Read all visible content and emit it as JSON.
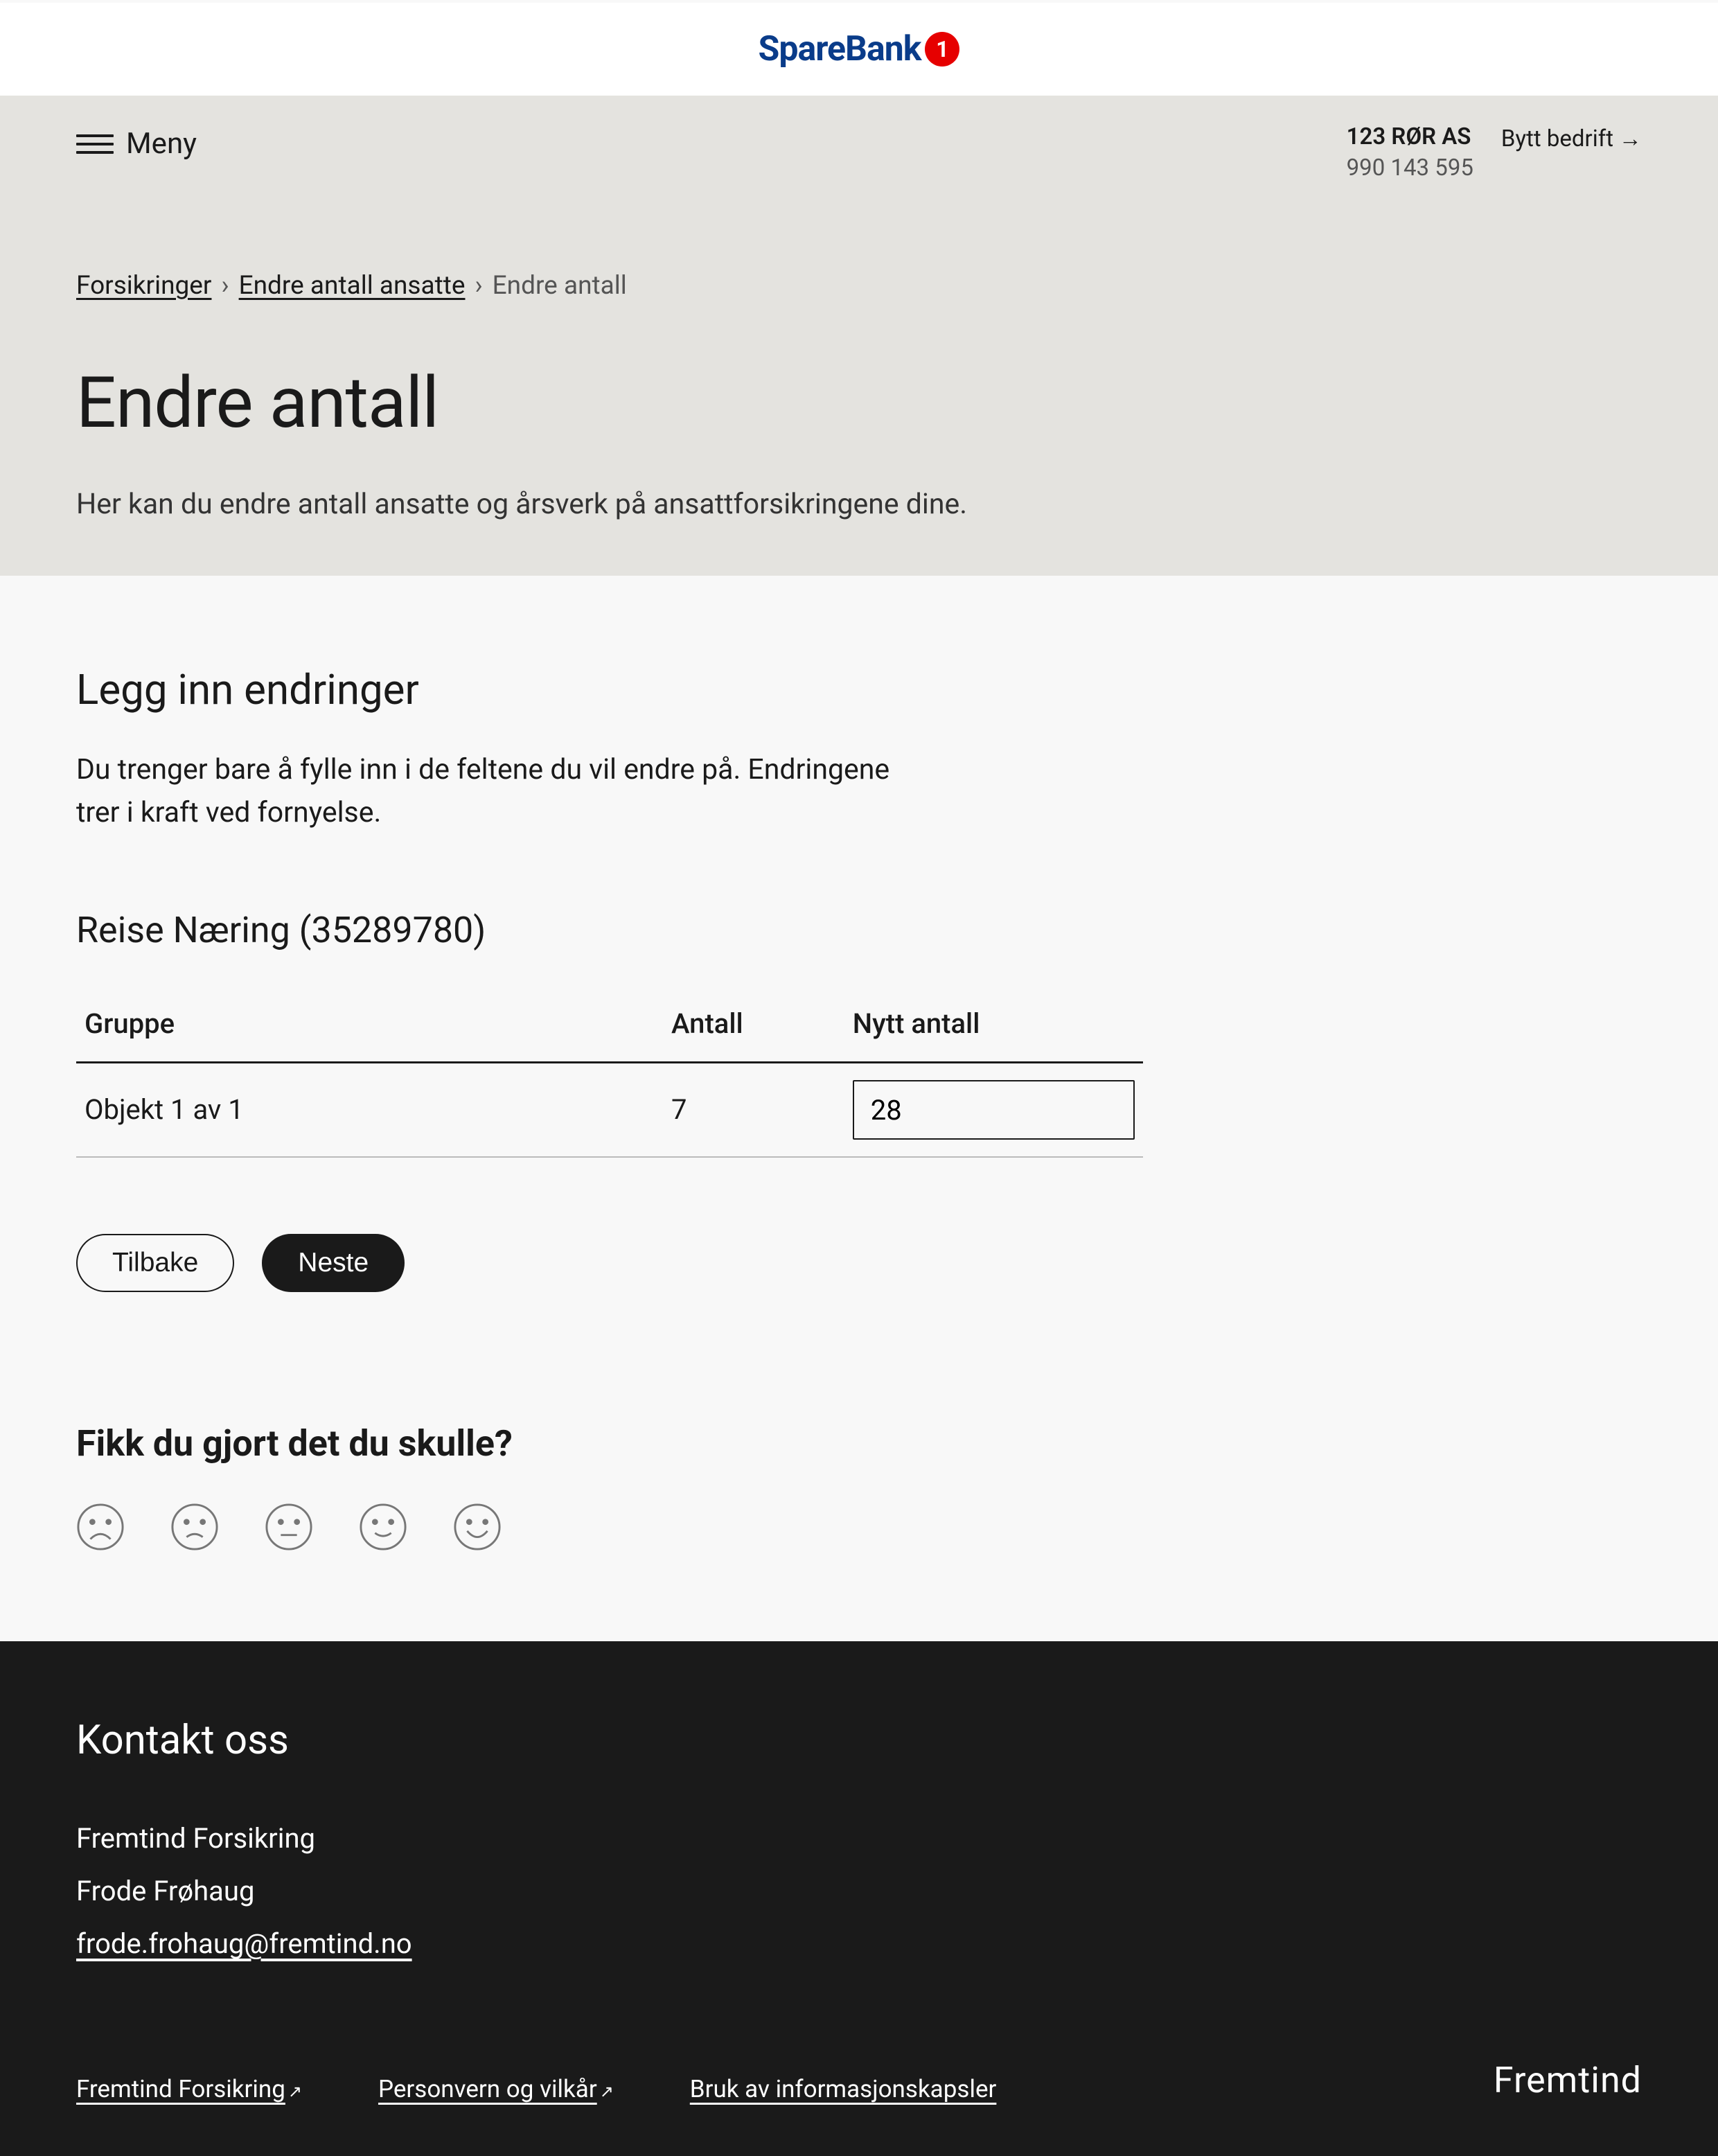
{
  "logo": {
    "text_a": "SpareBank",
    "badge": "1"
  },
  "menu": {
    "label": "Meny"
  },
  "company": {
    "name": "123 RØR AS",
    "org": "990 143 595",
    "switch_label": "Bytt bedrift"
  },
  "breadcrumb": {
    "items": [
      {
        "label": "Forsikringer",
        "link": true
      },
      {
        "label": "Endre antall ansatte",
        "link": true
      },
      {
        "label": "Endre antall",
        "link": false
      }
    ],
    "separator": "›"
  },
  "page": {
    "title": "Endre antall",
    "subtitle": "Her kan du endre antall ansatte og årsverk på ansattforsikringene dine."
  },
  "section": {
    "title": "Legg inn endringer",
    "desc": "Du trenger bare å fylle inn i de feltene du vil endre på. Endringene trer i kraft ved fornyelse."
  },
  "product": {
    "title": "Reise Næring (35289780)"
  },
  "table": {
    "headers": {
      "group": "Gruppe",
      "count": "Antall",
      "new_count": "Nytt antall"
    },
    "rows": [
      {
        "group": "Objekt 1 av 1",
        "count": "7",
        "new_count": "28"
      }
    ]
  },
  "buttons": {
    "back": "Tilbake",
    "next": "Neste"
  },
  "feedback": {
    "title": "Fikk du gjort det du skulle?"
  },
  "footer": {
    "title": "Kontakt oss",
    "company": "Fremtind Forsikring",
    "contact": "Frode Frøhaug",
    "email": "frode.frohaug@fremtind.no",
    "links": [
      {
        "label": "Fremtind Forsikring",
        "ext": true
      },
      {
        "label": "Personvern og vilkår",
        "ext": true
      },
      {
        "label": "Bruk av informasjonskapsler",
        "ext": false
      }
    ],
    "brand": "Fremtind"
  }
}
